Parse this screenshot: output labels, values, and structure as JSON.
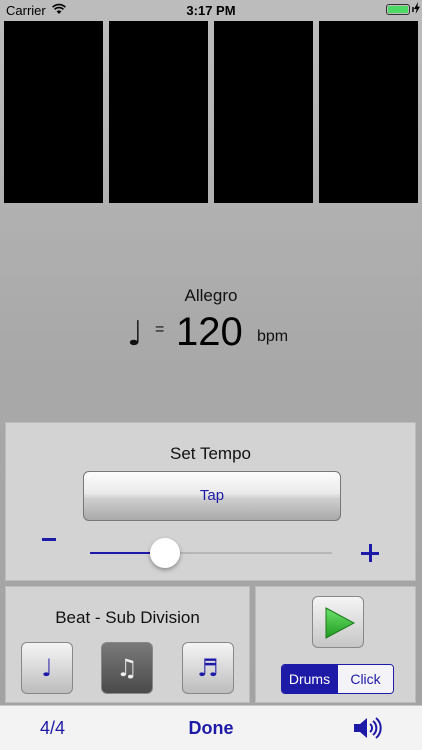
{
  "status_bar": {
    "carrier": "Carrier",
    "time": "3:17 PM",
    "battery_level": 1.0,
    "wifi_icon": "wifi-icon",
    "charging_icon": "lightning-icon"
  },
  "beat_indicators": {
    "count": 4,
    "color": "#000000"
  },
  "tempo": {
    "marking": "Allegro",
    "note_symbol": "♩",
    "equals": "=",
    "bpm": "120",
    "unit": "bpm"
  },
  "set_tempo": {
    "title": "Set Tempo",
    "tap_label": "Tap",
    "minus_icon": "minus-icon",
    "plus_icon": "plus-icon",
    "slider_value": 0.31
  },
  "subdivision": {
    "title": "Beat - Sub Division",
    "options": [
      {
        "icon": "quarter-note-icon",
        "glyph": "♩",
        "selected": false
      },
      {
        "icon": "eighth-notes-icon",
        "glyph": "♫",
        "selected": true
      },
      {
        "icon": "triplet-notes-icon",
        "glyph": "♬",
        "selected": false
      }
    ]
  },
  "transport": {
    "play_icon": "play-icon",
    "sound_modes": [
      "Drums",
      "Click"
    ],
    "selected_mode": "Drums"
  },
  "toolbar": {
    "time_signature": "4/4",
    "done_label": "Done",
    "speaker_icon": "speaker-icon"
  },
  "colors": {
    "accent": "#1e1aa8",
    "play_green": "#2fb52f",
    "panel": "#d3d3d3"
  }
}
